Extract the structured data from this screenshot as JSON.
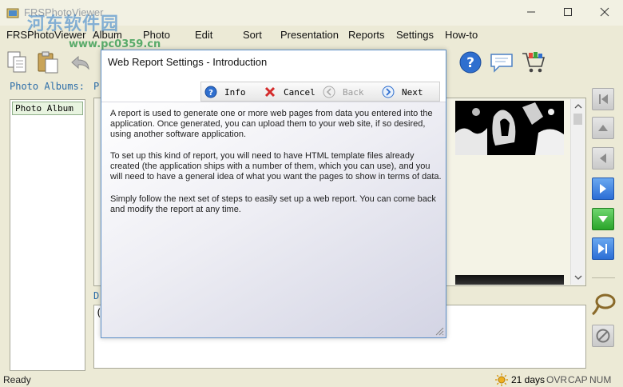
{
  "window": {
    "title": "FRSPhotoViewer",
    "watermark": "河东软件园",
    "watermark_url": "www.pc0359.cn"
  },
  "menu": [
    "FRSPhotoViewer",
    "Album",
    "Photo",
    "Edit",
    "Sort",
    "Presentation",
    "Reports",
    "Settings",
    "How-to"
  ],
  "panels": {
    "albums_label": "Photo Albums:",
    "photos_label": "P",
    "album_items": [
      "Photo Album"
    ],
    "description_label": "D",
    "description_value": "("
  },
  "dialog": {
    "title": "Web Report Settings - Introduction",
    "buttons": {
      "info": "Info",
      "cancel": "Cancel",
      "back": "Back",
      "next": "Next"
    },
    "paragraphs": [
      "A report is used to generate one or more web pages from data you entered into the application. Once generated, you can upload them to your web site, if so desired, using another software application.",
      "To set up this kind of report, you will need to have HTML template files already created (the application ships with a number of them, which you can use), and you will need to have a general idea of what you want the pages to show in terms of data.",
      "Simply follow the next set of steps to easily set up a web report. You can come back and modify the report at any time."
    ]
  },
  "status": {
    "text": "Ready",
    "days": "21 days",
    "ovr": "OVR",
    "cap": "CAP",
    "num": "NUM"
  },
  "colors": {
    "background": "#ecead6",
    "label_blue": "#2c6da8",
    "accent_blue": "#2b6ed6",
    "accent_green": "#2aa52a"
  }
}
